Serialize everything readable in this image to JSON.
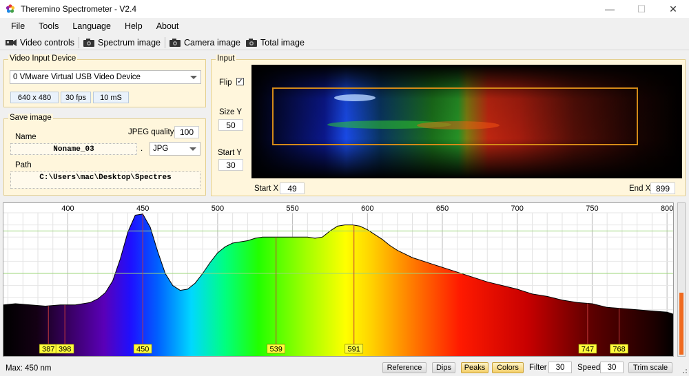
{
  "window": {
    "title": "Theremino Spectrometer - V2.4",
    "minimize": "—",
    "maximize": "☐",
    "close": "✕"
  },
  "menu": [
    "File",
    "Tools",
    "Language",
    "Help",
    "About"
  ],
  "toolbar": {
    "video_controls": "Video controls",
    "spectrum_image": "Spectrum image",
    "camera_image": "Camera image",
    "total_image": "Total image"
  },
  "video_input": {
    "title": "Video Input Device",
    "device": "0 VMware Virtual USB Video Device",
    "resolution": "640 x 480",
    "fps": "30 fps",
    "exposure": "10 mS"
  },
  "save_image": {
    "title": "Save image",
    "name_label": "Name",
    "name_value": "Noname_03",
    "dot": ".",
    "quality_label": "JPEG quality",
    "quality_value": "100",
    "format": "JPG",
    "path_label": "Path",
    "path_value": "C:\\Users\\mac\\Desktop\\Spectres"
  },
  "input": {
    "title": "Input",
    "flip_label": "Flip",
    "flip_checked": true,
    "size_y_label": "Size Y",
    "size_y_value": "50",
    "start_y_label": "Start Y",
    "start_y_value": "30",
    "start_x_label": "Start X",
    "start_x_value": "49",
    "end_x_label": "End X",
    "end_x_value": "899"
  },
  "chart_data": {
    "type": "area",
    "xlim": [
      357,
      805
    ],
    "ylim": [
      0,
      100
    ],
    "x_ticks": [
      400,
      450,
      500,
      550,
      600,
      650,
      700,
      750,
      800
    ],
    "x_unit": "nm",
    "grid": true,
    "x": [
      357,
      365,
      375,
      385,
      395,
      405,
      415,
      420,
      425,
      430,
      435,
      440,
      445,
      450,
      455,
      460,
      465,
      470,
      475,
      480,
      485,
      490,
      495,
      500,
      505,
      510,
      515,
      520,
      525,
      530,
      535,
      540,
      545,
      550,
      555,
      560,
      565,
      570,
      575,
      580,
      585,
      590,
      595,
      600,
      605,
      610,
      615,
      620,
      625,
      630,
      635,
      640,
      645,
      650,
      660,
      670,
      680,
      690,
      700,
      710,
      720,
      730,
      740,
      750,
      760,
      770,
      780,
      790,
      800,
      805
    ],
    "y": [
      24,
      25,
      24,
      23,
      24,
      24,
      26,
      29,
      34,
      44,
      62,
      84,
      98,
      99,
      88,
      68,
      50,
      40,
      36,
      37,
      42,
      50,
      59,
      67,
      72,
      75,
      76,
      77,
      79,
      80,
      80,
      80,
      80,
      80,
      80,
      80,
      79,
      80,
      85,
      89,
      90,
      90,
      89,
      86,
      82,
      78,
      73,
      69,
      66,
      63,
      61,
      59,
      57,
      55,
      51,
      47,
      43,
      40,
      37,
      33,
      31,
      28,
      26,
      25,
      22,
      21,
      20,
      19,
      18,
      16
    ],
    "peaks": [
      387,
      398,
      450,
      539,
      591,
      747,
      768
    ],
    "guide_lines_y": [
      50,
      85
    ],
    "guide_line_color": "#9cd57a",
    "peak_line_color": "#c43a3a",
    "peak_label_bg": "#fffb3c"
  },
  "status": {
    "max_label": "Max: 450 nm",
    "reference": "Reference",
    "dips": "Dips",
    "peaks": "Peaks",
    "colors": "Colors",
    "filter_label": "Filter",
    "filter_value": "30",
    "speed_label": "Speed",
    "speed_value": "30",
    "trim_scale": "Trim scale"
  }
}
